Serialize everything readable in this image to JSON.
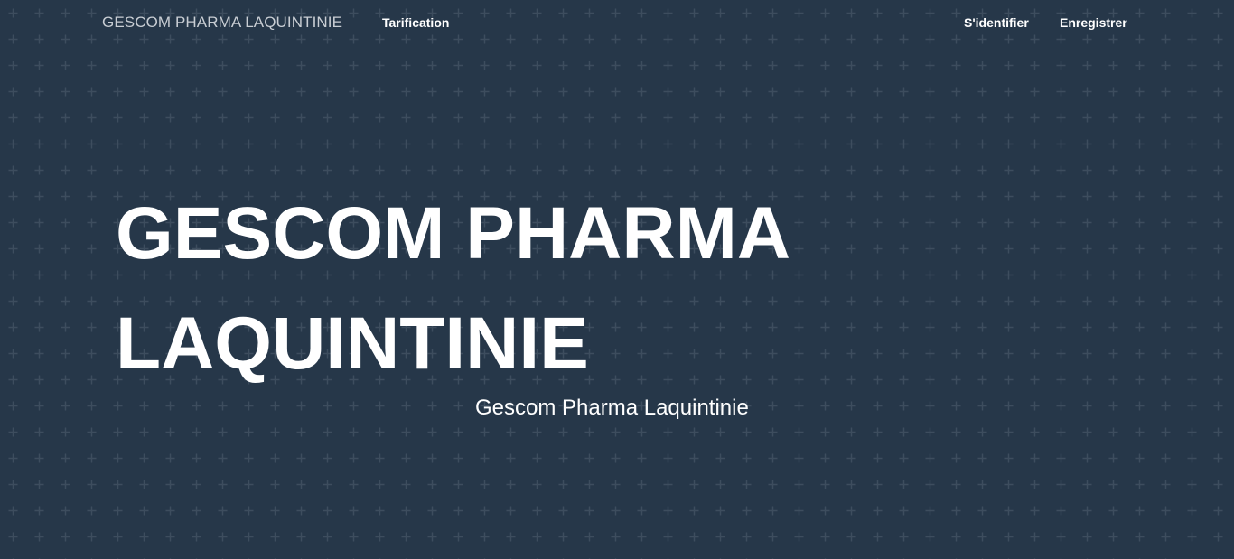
{
  "navbar": {
    "brand": "GESCOM PHARMA LAQUINTINIE",
    "links": {
      "pricing": "Tarification",
      "login": "S'identifier",
      "register": "Enregistrer"
    }
  },
  "hero": {
    "title": "GESCOM PHARMA LAQUINTINIE",
    "subtitle": "Gescom Pharma Laquintinie"
  },
  "colors": {
    "background": "#263749",
    "pattern": "#3b4b5c",
    "text": "#ffffff",
    "brand_text": "#c9ced4"
  }
}
